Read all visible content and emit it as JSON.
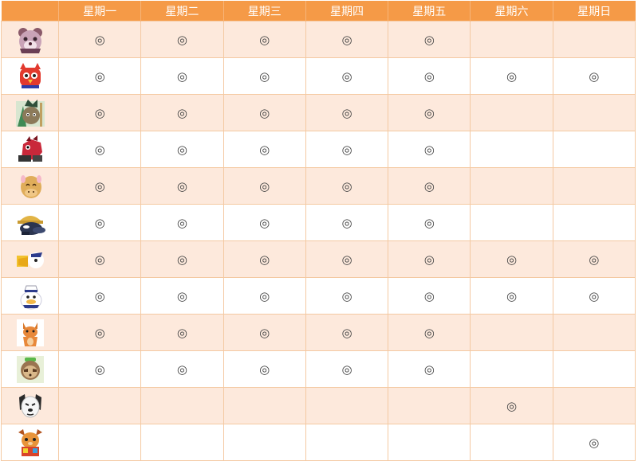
{
  "header": {
    "days": [
      "星期一",
      "星期二",
      "星期三",
      "星期四",
      "星期五",
      "星期六",
      "星期日"
    ]
  },
  "mark_symbol": "◎",
  "rows": [
    {
      "avatar": "bear-avatar-icon",
      "marks": [
        1,
        1,
        1,
        1,
        1,
        0,
        0
      ]
    },
    {
      "avatar": "red-bird-avatar-icon",
      "marks": [
        1,
        1,
        1,
        1,
        1,
        1,
        1
      ]
    },
    {
      "avatar": "cat-warrior-avatar-icon",
      "marks": [
        1,
        1,
        1,
        1,
        1,
        0,
        0
      ]
    },
    {
      "avatar": "red-dinosaur-avatar-icon",
      "marks": [
        1,
        1,
        1,
        1,
        1,
        0,
        0
      ]
    },
    {
      "avatar": "camel-avatar-icon",
      "marks": [
        1,
        1,
        1,
        1,
        1,
        0,
        0
      ]
    },
    {
      "avatar": "mole-avatar-icon",
      "marks": [
        1,
        1,
        1,
        1,
        1,
        0,
        0
      ]
    },
    {
      "avatar": "pelican-avatar-icon",
      "marks": [
        1,
        1,
        1,
        1,
        1,
        1,
        1
      ]
    },
    {
      "avatar": "pelican-sailor-avatar-icon",
      "marks": [
        1,
        1,
        1,
        1,
        1,
        1,
        1
      ]
    },
    {
      "avatar": "fox-avatar-icon",
      "marks": [
        1,
        1,
        1,
        1,
        1,
        0,
        0
      ]
    },
    {
      "avatar": "sloth-avatar-icon",
      "marks": [
        1,
        1,
        1,
        1,
        1,
        0,
        0
      ]
    },
    {
      "avatar": "white-dog-avatar-icon",
      "marks": [
        0,
        0,
        0,
        0,
        0,
        1,
        0
      ]
    },
    {
      "avatar": "squirrel-avatar-icon",
      "marks": [
        0,
        0,
        0,
        0,
        0,
        0,
        1
      ]
    }
  ]
}
